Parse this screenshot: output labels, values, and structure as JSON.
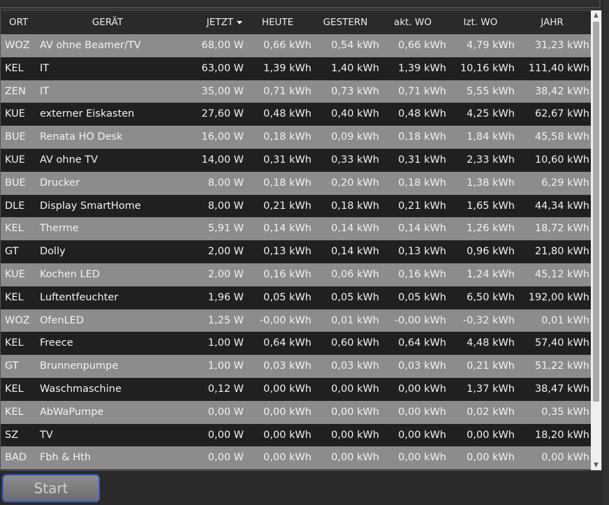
{
  "table": {
    "columns": [
      {
        "key": "ort",
        "label": "ORT"
      },
      {
        "key": "geraet",
        "label": "GERÄT"
      },
      {
        "key": "jetzt",
        "label": "JETZT"
      },
      {
        "key": "heute",
        "label": "HEUTE"
      },
      {
        "key": "gestern",
        "label": "GESTERN"
      },
      {
        "key": "akt_wo",
        "label": "akt. WO"
      },
      {
        "key": "lzt_wo",
        "label": "lzt. WO"
      },
      {
        "key": "jahr",
        "label": "JAHR"
      }
    ],
    "sort_column": "JETZT",
    "sort_direction": "descending",
    "rows": [
      {
        "ort": "WOZ",
        "geraet": "AV ohne Beamer/TV",
        "jetzt": "68,00 W",
        "heute": "0,66 kWh",
        "gestern": "0,54 kWh",
        "akt_wo": "0,66 kWh",
        "lzt_wo": "4,79 kWh",
        "jahr": "31,23 kWh"
      },
      {
        "ort": "KEL",
        "geraet": "IT",
        "jetzt": "63,00 W",
        "heute": "1,39 kWh",
        "gestern": "1,40 kWh",
        "akt_wo": "1,39 kWh",
        "lzt_wo": "10,16 kWh",
        "jahr": "111,40 kWh"
      },
      {
        "ort": "ZEN",
        "geraet": "IT",
        "jetzt": "35,00 W",
        "heute": "0,71 kWh",
        "gestern": "0,73 kWh",
        "akt_wo": "0,71 kWh",
        "lzt_wo": "5,55 kWh",
        "jahr": "38,42 kWh"
      },
      {
        "ort": "KUE",
        "geraet": "externer Eiskasten",
        "jetzt": "27,60 W",
        "heute": "0,48 kWh",
        "gestern": "0,40 kWh",
        "akt_wo": "0,48 kWh",
        "lzt_wo": "4,25 kWh",
        "jahr": "62,67 kWh"
      },
      {
        "ort": "BUE",
        "geraet": "Renata HO Desk",
        "jetzt": "16,00 W",
        "heute": "0,18 kWh",
        "gestern": "0,09 kWh",
        "akt_wo": "0,18 kWh",
        "lzt_wo": "1,84 kWh",
        "jahr": "45,58 kWh"
      },
      {
        "ort": "KUE",
        "geraet": "AV ohne TV",
        "jetzt": "14,00 W",
        "heute": "0,31 kWh",
        "gestern": "0,33 kWh",
        "akt_wo": "0,31 kWh",
        "lzt_wo": "2,33 kWh",
        "jahr": "10,60 kWh"
      },
      {
        "ort": "BUE",
        "geraet": "Drucker",
        "jetzt": "8,00 W",
        "heute": "0,18 kWh",
        "gestern": "0,20 kWh",
        "akt_wo": "0,18 kWh",
        "lzt_wo": "1,38 kWh",
        "jahr": "6,29 kWh"
      },
      {
        "ort": "DLE",
        "geraet": "Display SmartHome",
        "jetzt": "8,00 W",
        "heute": "0,21 kWh",
        "gestern": "0,18 kWh",
        "akt_wo": "0,21 kWh",
        "lzt_wo": "1,65 kWh",
        "jahr": "44,34 kWh"
      },
      {
        "ort": "KEL",
        "geraet": "Therme",
        "jetzt": "5,91 W",
        "heute": "0,14 kWh",
        "gestern": "0,14 kWh",
        "akt_wo": "0,14 kWh",
        "lzt_wo": "1,26 kWh",
        "jahr": "18,72 kWh"
      },
      {
        "ort": "GT",
        "geraet": "Dolly",
        "jetzt": "2,00 W",
        "heute": "0,13 kWh",
        "gestern": "0,14 kWh",
        "akt_wo": "0,13 kWh",
        "lzt_wo": "0,96 kWh",
        "jahr": "21,80 kWh"
      },
      {
        "ort": "KUE",
        "geraet": "Kochen LED",
        "jetzt": "2,00 W",
        "heute": "0,16 kWh",
        "gestern": "0,06 kWh",
        "akt_wo": "0,16 kWh",
        "lzt_wo": "1,24 kWh",
        "jahr": "45,12 kWh"
      },
      {
        "ort": "KEL",
        "geraet": "Luftentfeuchter",
        "jetzt": "1,96 W",
        "heute": "0,05 kWh",
        "gestern": "0,05 kWh",
        "akt_wo": "0,05 kWh",
        "lzt_wo": "6,50 kWh",
        "jahr": "192,00 kWh"
      },
      {
        "ort": "WOZ",
        "geraet": "OfenLED",
        "jetzt": "1,25 W",
        "heute": "-0,00 kWh",
        "gestern": "0,01 kWh",
        "akt_wo": "-0,00 kWh",
        "lzt_wo": "-0,32 kWh",
        "jahr": "0,01 kWh"
      },
      {
        "ort": "KEL",
        "geraet": "Freece",
        "jetzt": "1,00 W",
        "heute": "0,64 kWh",
        "gestern": "0,60 kWh",
        "akt_wo": "0,64 kWh",
        "lzt_wo": "4,48 kWh",
        "jahr": "57,40 kWh"
      },
      {
        "ort": "GT",
        "geraet": "Brunnenpumpe",
        "jetzt": "1,00 W",
        "heute": "0,03 kWh",
        "gestern": "0,03 kWh",
        "akt_wo": "0,03 kWh",
        "lzt_wo": "0,21 kWh",
        "jahr": "51,22 kWh"
      },
      {
        "ort": "KEL",
        "geraet": "Waschmaschine",
        "jetzt": "0,12 W",
        "heute": "0,00 kWh",
        "gestern": "0,00 kWh",
        "akt_wo": "0,00 kWh",
        "lzt_wo": "1,37 kWh",
        "jahr": "38,47 kWh"
      },
      {
        "ort": "KEL",
        "geraet": "AbWaPumpe",
        "jetzt": "0,00 W",
        "heute": "0,00 kWh",
        "gestern": "0,00 kWh",
        "akt_wo": "0,00 kWh",
        "lzt_wo": "0,02 kWh",
        "jahr": "0,35 kWh"
      },
      {
        "ort": "SZ",
        "geraet": "TV",
        "jetzt": "0,00 W",
        "heute": "0,00 kWh",
        "gestern": "0,00 kWh",
        "akt_wo": "0,00 kWh",
        "lzt_wo": "0,00 kWh",
        "jahr": "18,20 kWh"
      },
      {
        "ort": "BAD",
        "geraet": "Fbh & Hth",
        "jetzt": "0,00 W",
        "heute": "0,00 kWh",
        "gestern": "0,00 kWh",
        "akt_wo": "0,00 kWh",
        "lzt_wo": "0,00 kWh",
        "jahr": "0,00 kWh"
      }
    ]
  },
  "scrollbar": {
    "up_icon": "scroll-up-arrow-icon",
    "down_icon": "scroll-down-arrow-icon"
  },
  "start_button": {
    "label": "Start"
  },
  "colors": {
    "row_odd": "#8c8c8c",
    "row_even": "#202020",
    "header_bg": "#2a2a2a",
    "button_border": "#3a5fcf"
  }
}
